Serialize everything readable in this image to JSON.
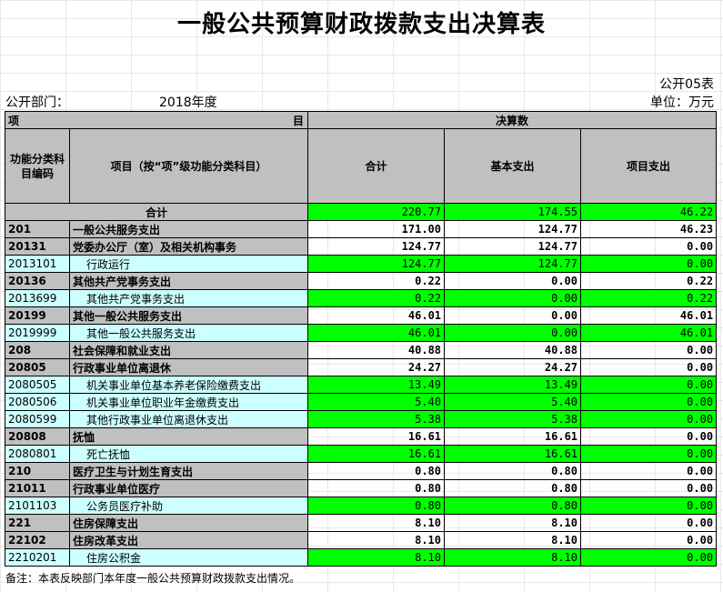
{
  "title": "一般公共预算财政拨款支出决算表",
  "form_no": "公开05表",
  "dept_label": "公开部门：",
  "year": "2018年度",
  "unit": "单位：万元",
  "header": {
    "xiang": "项",
    "mu": "目",
    "juesuanshu": "决算数",
    "code_col": "功能分类科目编码",
    "name_col": "项目（按“项”级功能分类科目）",
    "total_col": "合计",
    "basic_col": "基本支出",
    "project_col": "项目支出"
  },
  "total_row": {
    "label": "合计",
    "total": "220.77",
    "basic": "174.55",
    "project": "46.22"
  },
  "rows": [
    {
      "code": "201",
      "name": "一般公共服务支出",
      "total": "171.00",
      "basic": "124.77",
      "project": "46.23",
      "level": 1
    },
    {
      "code": "20131",
      "name": "党委办公厅（室）及相关机构事务",
      "total": "124.77",
      "basic": "124.77",
      "project": "0.00",
      "level": 1
    },
    {
      "code": "2013101",
      "name": "行政运行",
      "total": "124.77",
      "basic": "124.77",
      "project": "0.00",
      "level": 2
    },
    {
      "code": "20136",
      "name": "其他共产党事务支出",
      "total": "0.22",
      "basic": "0.00",
      "project": "0.22",
      "level": 1
    },
    {
      "code": "2013699",
      "name": "其他共产党事务支出",
      "total": "0.22",
      "basic": "0.00",
      "project": "0.22",
      "level": 2
    },
    {
      "code": "20199",
      "name": "其他一般公共服务支出",
      "total": "46.01",
      "basic": "0.00",
      "project": "46.01",
      "level": 1
    },
    {
      "code": "2019999",
      "name": "其他一般公共服务支出",
      "total": "46.01",
      "basic": "0.00",
      "project": "46.01",
      "level": 2
    },
    {
      "code": "208",
      "name": "社会保障和就业支出",
      "total": "40.88",
      "basic": "40.88",
      "project": "0.00",
      "level": 1
    },
    {
      "code": "20805",
      "name": "行政事业单位离退休",
      "total": "24.27",
      "basic": "24.27",
      "project": "0.00",
      "level": 1
    },
    {
      "code": "2080505",
      "name": "机关事业单位基本养老保险缴费支出",
      "total": "13.49",
      "basic": "13.49",
      "project": "0.00",
      "level": 2
    },
    {
      "code": "2080506",
      "name": "机关事业单位职业年金缴费支出",
      "total": "5.40",
      "basic": "5.40",
      "project": "0.00",
      "level": 2
    },
    {
      "code": "2080599",
      "name": "其他行政事业单位离退休支出",
      "total": "5.38",
      "basic": "5.38",
      "project": "0.00",
      "level": 2
    },
    {
      "code": "20808",
      "name": "抚恤",
      "total": "16.61",
      "basic": "16.61",
      "project": "0.00",
      "level": 1
    },
    {
      "code": "2080801",
      "name": "死亡抚恤",
      "total": "16.61",
      "basic": "16.61",
      "project": "0.00",
      "level": 2
    },
    {
      "code": "210",
      "name": "医疗卫生与计划生育支出",
      "total": "0.80",
      "basic": "0.80",
      "project": "0.00",
      "level": 1
    },
    {
      "code": "21011",
      "name": "行政事业单位医疗",
      "total": "0.80",
      "basic": "0.80",
      "project": "0.00",
      "level": 1
    },
    {
      "code": "2101103",
      "name": "公务员医疗补助",
      "total": "0.80",
      "basic": "0.80",
      "project": "0.00",
      "level": 2
    },
    {
      "code": "221",
      "name": "住房保障支出",
      "total": "8.10",
      "basic": "8.10",
      "project": "0.00",
      "level": 1
    },
    {
      "code": "22102",
      "name": "住房改革支出",
      "total": "8.10",
      "basic": "8.10",
      "project": "0.00",
      "level": 1
    },
    {
      "code": "2210201",
      "name": "住房公积金",
      "total": "8.10",
      "basic": "8.10",
      "project": "0.00",
      "level": 2
    }
  ],
  "note": "备注：本表反映部门本年度一般公共预算财政拨款支出情况。",
  "colors": {
    "header_gray": "#c0c0c0",
    "light_blue": "#ccffff",
    "green": "#00ff00"
  }
}
